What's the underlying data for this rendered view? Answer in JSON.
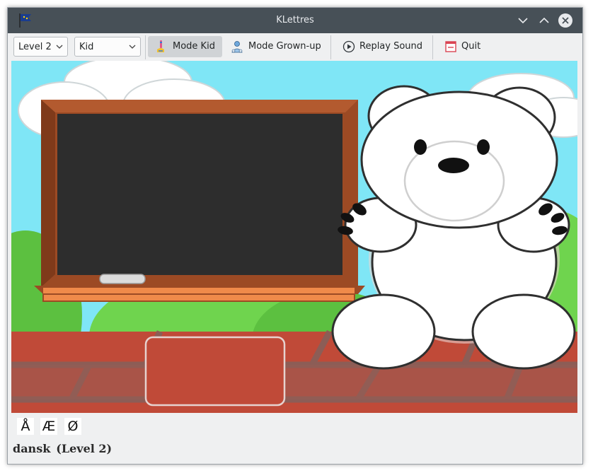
{
  "window": {
    "title": "KLettres"
  },
  "toolbar": {
    "level_combo": {
      "selected": "Level 2"
    },
    "mode_combo": {
      "selected": "Kid"
    },
    "mode_kid_label": "Mode Kid",
    "mode_grownup_label": "Mode Grown-up",
    "replay_sound_label": "Replay Sound",
    "quit_label": "Quit"
  },
  "special_letters": [
    "Å",
    "Æ",
    "Ø"
  ],
  "status": {
    "language": "dansk",
    "level": "(Level 2)"
  },
  "colors": {
    "titlebar": "#475057",
    "sky": "#7fe6f6",
    "bricks": "#c04a38",
    "blackboard": "#2d2d2d",
    "frame": "#9c4a24"
  },
  "icons": {
    "app": "flag-icon",
    "minimize": "chevron-down-icon",
    "maximize": "chevron-up-icon",
    "close": "close-icon",
    "mode_kid": "kid-icon",
    "mode_grownup": "grownup-icon",
    "replay": "play-circle-icon",
    "quit": "quit-icon"
  }
}
